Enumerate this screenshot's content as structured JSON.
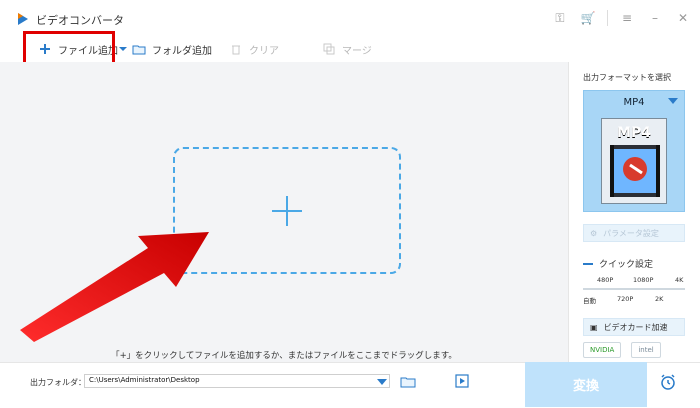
{
  "app": {
    "title": "ビデオコンバータ"
  },
  "toolbar": {
    "add_file": "ファイル追加",
    "add_folder": "フォルダ追加",
    "clear": "クリア",
    "merge": "マージ"
  },
  "main": {
    "hint": "「+」をクリックしてファイルを追加するか、またはファイルをここまでドラッグします。"
  },
  "right_panel": {
    "title": "出力フォーマットを選択",
    "format": "MP4",
    "format_tile_label": "MP4",
    "param_button": "パラメータ設定",
    "quick_settings": "クイック設定",
    "quality_top": [
      "480P",
      "1080P",
      "4K"
    ],
    "quality_bottom": [
      "自動",
      "720P",
      "2K"
    ],
    "gpu_accel": "ビデオカード加速",
    "chips": [
      "NVIDIA",
      "intel"
    ]
  },
  "bottom": {
    "output_label": "出力フォルダ：",
    "output_path": "C:\\Users\\Administrator\\Desktop",
    "convert": "変換"
  },
  "colors": {
    "accent": "#4aa8e6",
    "highlight": "#e00000",
    "arrow": "#e00000"
  }
}
